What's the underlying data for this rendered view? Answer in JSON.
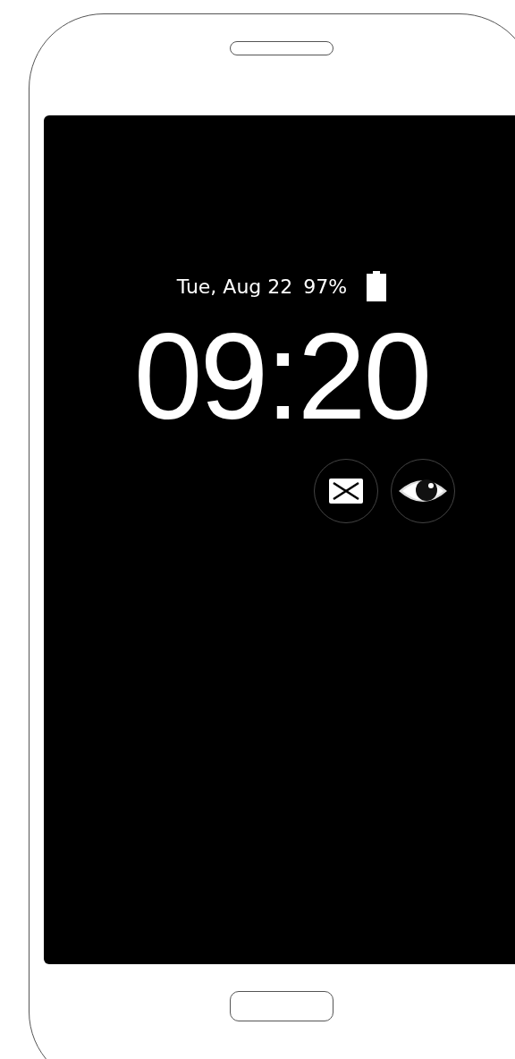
{
  "lock_screen": {
    "date": "Tue, Aug 22",
    "battery": "97%",
    "time": "09:20"
  }
}
